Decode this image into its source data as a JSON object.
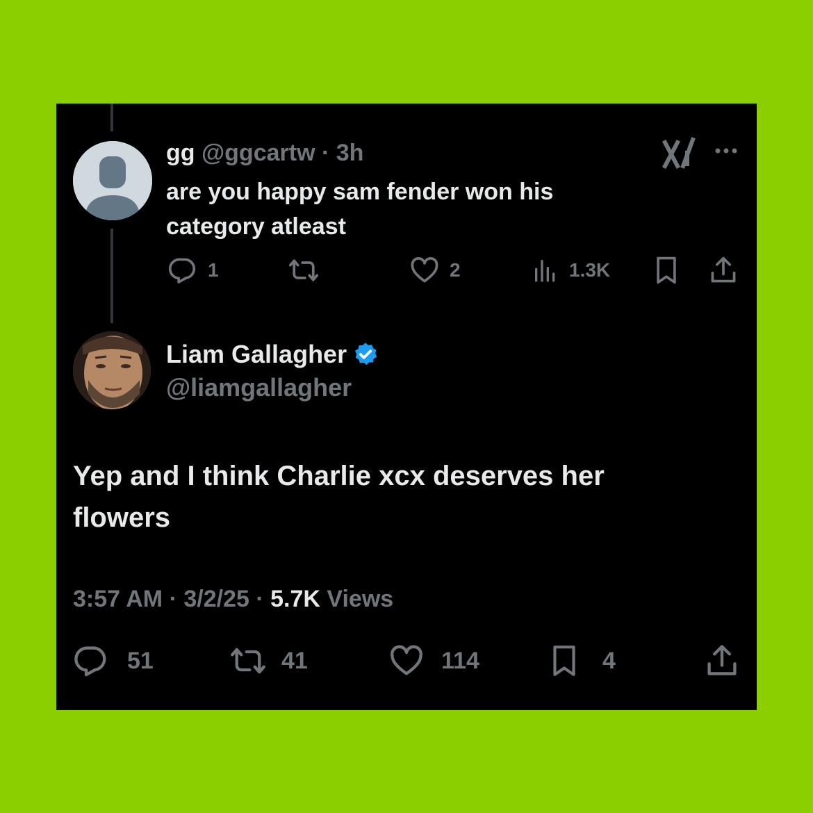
{
  "quoted_tweet": {
    "display_name": "gg",
    "handle": "@ggcartw",
    "separator": "·",
    "time": "3h",
    "text": "are you happy sam fender won his category atleast",
    "stats": {
      "replies": "1",
      "reposts": "",
      "likes": "2",
      "views": "1.3K"
    }
  },
  "main_tweet": {
    "display_name": "Liam Gallagher",
    "handle": "@liamgallagher",
    "verified": true,
    "text": "Yep and I think Charlie xcx deserves her flowers",
    "time": "3:57 AM",
    "date": "3/2/25",
    "separator": "·",
    "views_count": "5.7K",
    "views_label": "Views",
    "stats": {
      "replies": "51",
      "reposts": "41",
      "likes": "114",
      "bookmarks": "4"
    }
  },
  "icons": [
    "x-logo-icon",
    "more-icon",
    "reply-icon",
    "repost-icon",
    "like-icon",
    "views-icon",
    "bookmark-icon",
    "share-icon",
    "verified-badge-icon"
  ],
  "colors": {
    "background": "#8ccf00",
    "card": "#000000",
    "primary_text": "#e7e9ea",
    "secondary_text": "#71767b",
    "verified": "#1d9bf0"
  }
}
